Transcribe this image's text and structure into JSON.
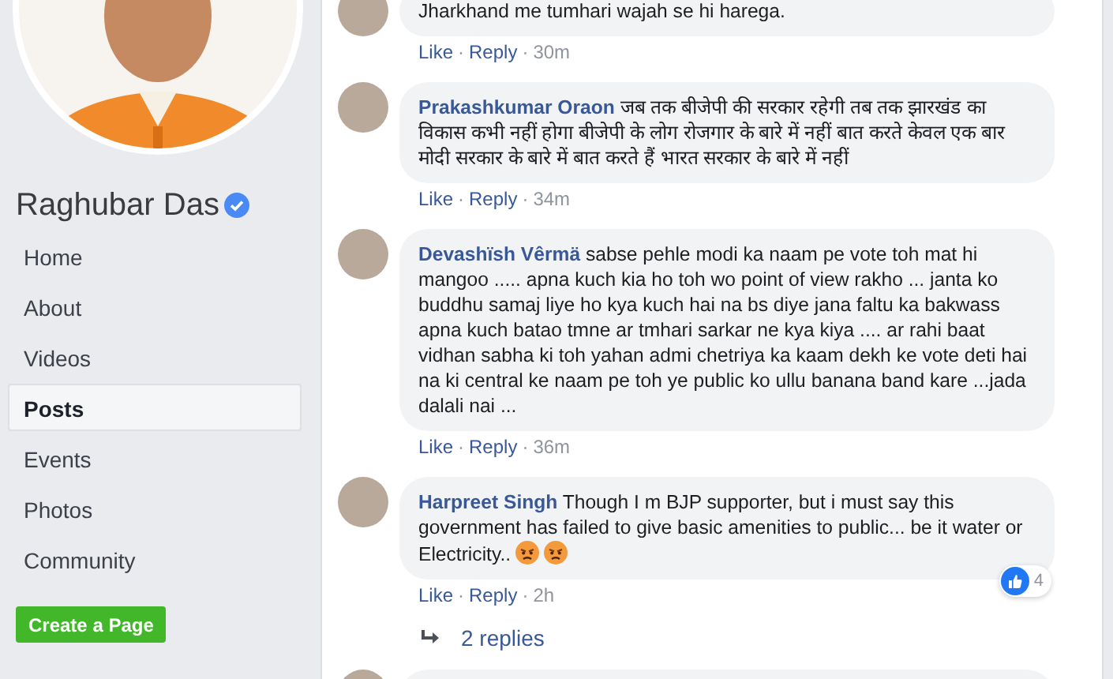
{
  "page": {
    "name": "Raghubar Das",
    "verified": true
  },
  "nav": [
    {
      "label": "Home",
      "selected": false
    },
    {
      "label": "About",
      "selected": false
    },
    {
      "label": "Videos",
      "selected": false
    },
    {
      "label": "Posts",
      "selected": true
    },
    {
      "label": "Events",
      "selected": false
    },
    {
      "label": "Photos",
      "selected": false
    },
    {
      "label": "Community",
      "selected": false
    }
  ],
  "create_button": "Create a Page",
  "separator": "·",
  "comments": [
    {
      "kind": "comment",
      "text": "Jharkhand me tumhari wajah se hi harega.",
      "actions": [
        "Like",
        "Reply"
      ],
      "time": "30m"
    },
    {
      "kind": "comment",
      "author": "Prakashkumar Oraon",
      "text": "जब तक बीजेपी की सरकार रहेगी तब तक झारखंड का विकास कभी नहीं होगा बीजेपी के लोग रोजगार के बारे में नहीं बात करते केवल एक बार मोदी सरकार के बारे में बात करते हैं भारत सरकार के बारे में नहीं",
      "actions": [
        "Like",
        "Reply"
      ],
      "time": "34m"
    },
    {
      "kind": "comment",
      "author": "Devashïsh Vêrmä",
      "text": "sabse pehle modi ka naam pe vote toh mat hi mangoo ..... apna kuch kia ho toh wo point of view rakho ... janta ko buddhu samaj liye ho kya kuch hai na bs diye jana faltu ka bakwass apna kuch batao tmne ar tmhari sarkar ne kya kiya .... ar rahi baat vidhan sabha ki toh yahan admi chetriya ka kaam dekh ke vote deti hai na ki central ke naam pe toh ye public ko ullu banana band kare ...jada dalali nai ...",
      "actions": [
        "Like",
        "Reply"
      ],
      "time": "36m"
    },
    {
      "kind": "comment",
      "author": "Harpreet Singh",
      "text": "Though I m BJP supporter, but i must say this government has failed to give basic amenities to public... be it water or Electricity..",
      "emoji": [
        {
          "kind": "angry"
        },
        {
          "kind": "angry"
        }
      ],
      "reaction_count": "4",
      "actions": [
        "Like",
        "Reply"
      ],
      "time": "2h",
      "replies": "2 replies"
    },
    {
      "kind": "clipped"
    }
  ]
}
